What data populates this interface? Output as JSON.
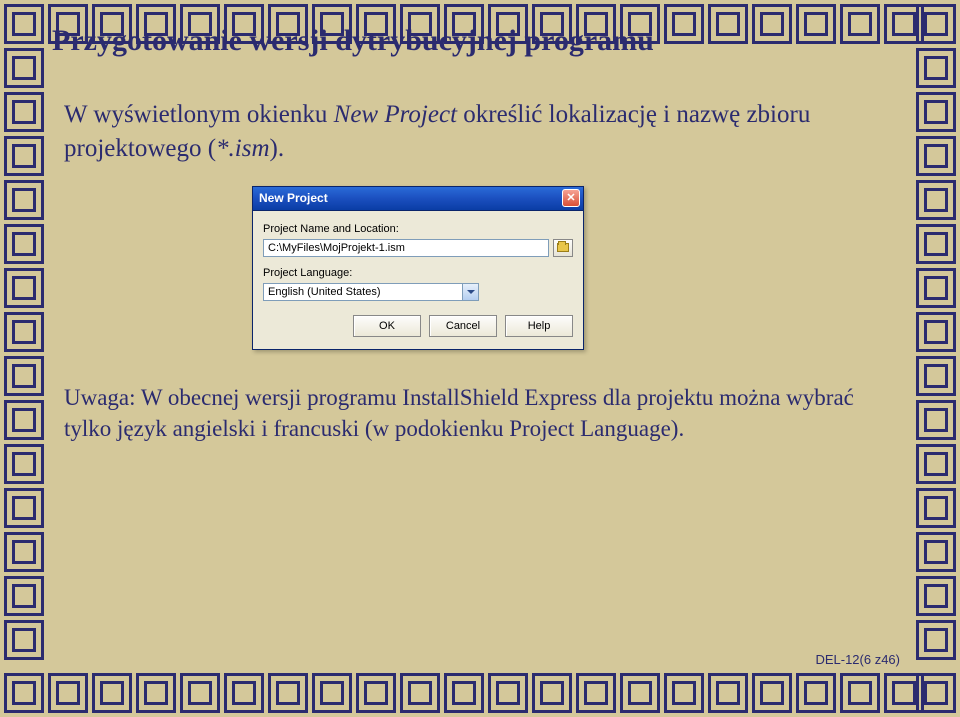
{
  "title": "Przygotowanie wersji dytrybucyjnej programu",
  "body": {
    "prefix": "W wyświetlonym okienku ",
    "em1": "New Project",
    "mid": " określić lokalizację i nazwę zbioru projektowego (",
    "em2": "*.ism",
    "suffix": ")."
  },
  "dialog": {
    "title": "New Project",
    "close_glyph": "✕",
    "label_location": "Project Name and Location:",
    "path_value": "C:\\MyFiles\\MojProjekt-1.ism",
    "label_language": "Project Language:",
    "language_value": "English (United States)",
    "buttons": {
      "ok": "OK",
      "cancel": "Cancel",
      "help": "Help"
    }
  },
  "note": {
    "prefix": "Uwaga: W obecnej wersji programu InstallShield Express dla projektu można wybrać tylko język angielski i francuski (w podokienku ",
    "em": "Project Language",
    "suffix": ")."
  },
  "footer": "DEL-12(6 z46)"
}
